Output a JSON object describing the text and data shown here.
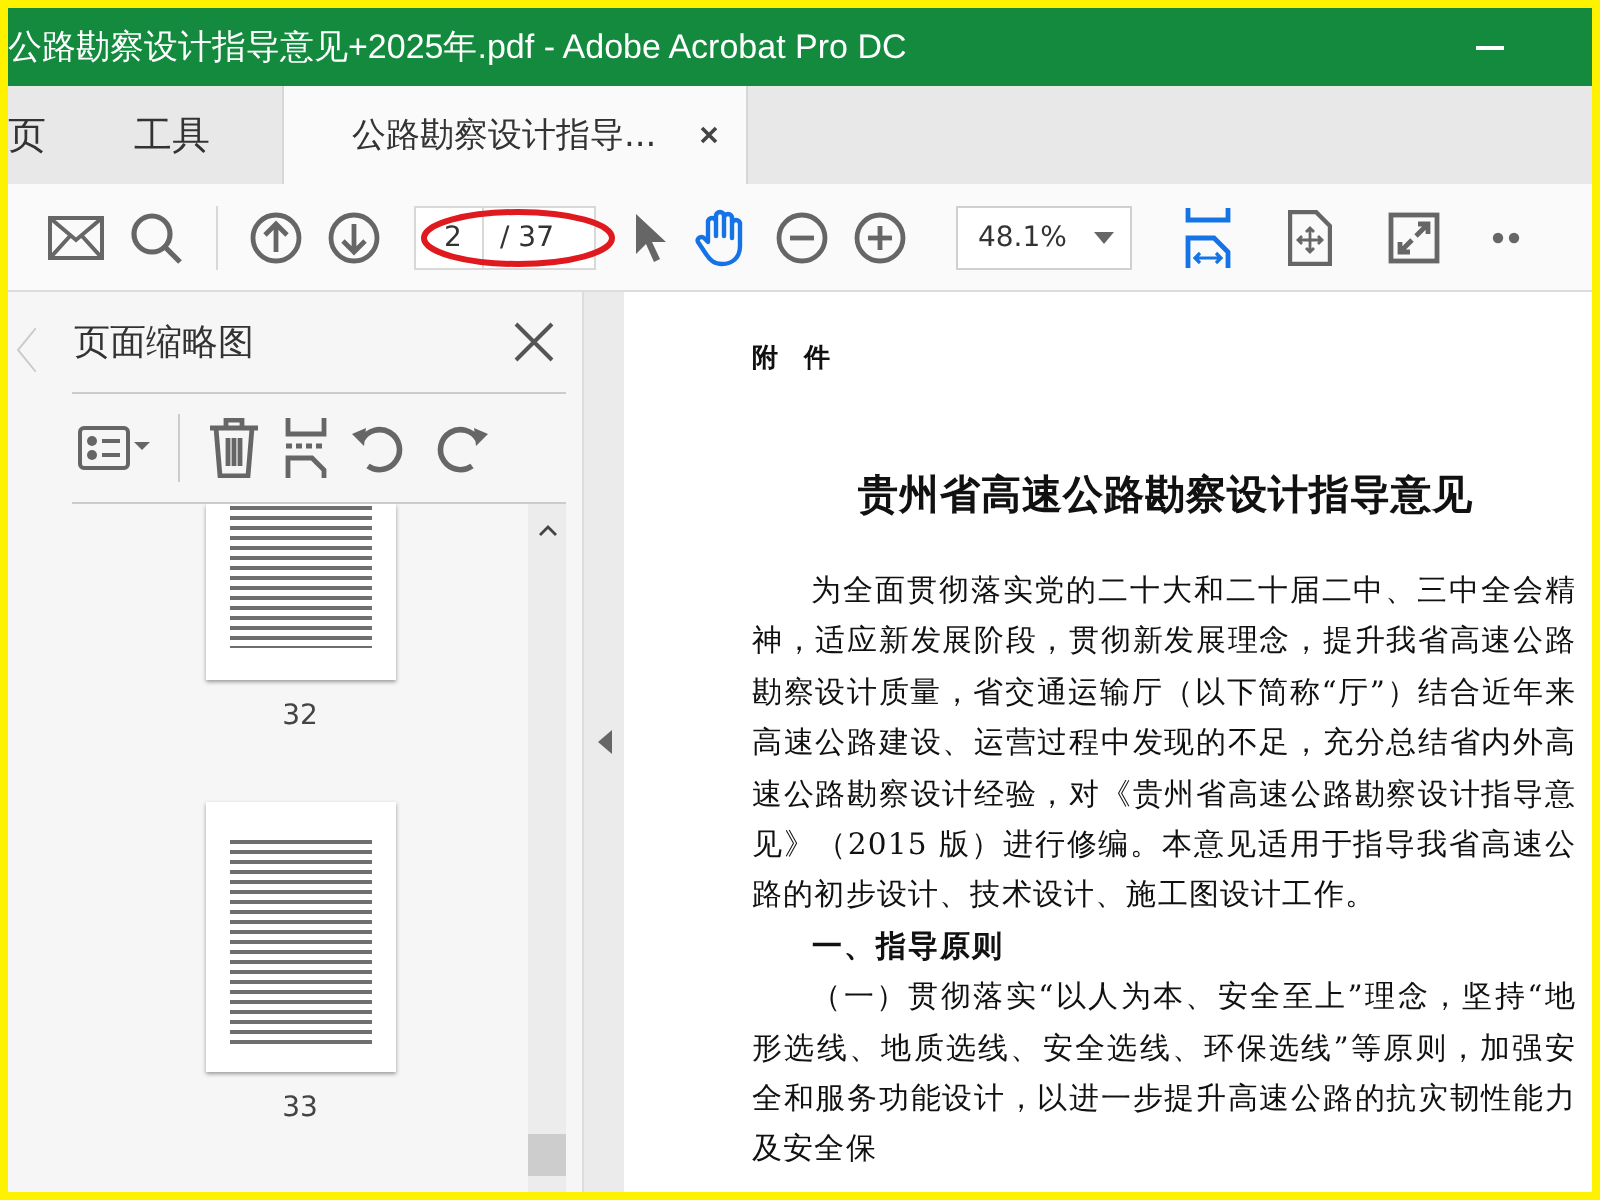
{
  "window": {
    "title": "公路勘察设计指导意见+2025年.pdf - Adobe Acrobat Pro DC"
  },
  "tabs": [
    {
      "label": "页",
      "selected": false
    },
    {
      "label": "工具",
      "selected": false
    },
    {
      "label": "公路勘察设计指导...",
      "selected": true
    }
  ],
  "toolbar": {
    "tools": [
      {
        "kind": "mail",
        "selected": false
      },
      {
        "kind": "search",
        "selected": false
      },
      {
        "kind": "sep"
      },
      {
        "kind": "up",
        "selected": false
      },
      {
        "kind": "down",
        "selected": false
      },
      {
        "kind": "page",
        "value": "2",
        "total": "/ 37"
      },
      {
        "kind": "pointer",
        "selected": false
      },
      {
        "kind": "hand",
        "selected": true
      },
      {
        "kind": "zoomout",
        "selected": false
      },
      {
        "kind": "zoomin",
        "selected": false
      },
      {
        "kind": "zoom",
        "value": "48.1%"
      },
      {
        "kind": "fitwidth",
        "selected": true
      },
      {
        "kind": "fitpage",
        "selected": false
      },
      {
        "kind": "fullscreen",
        "selected": false
      },
      {
        "kind": "more",
        "selected": false
      }
    ]
  },
  "sidebar": {
    "title": "页面缩略图",
    "thumbnails": [
      {
        "page": "32",
        "kind": "cut_top"
      },
      {
        "page": "33",
        "kind": "full"
      }
    ]
  },
  "document": {
    "heading": "附　件",
    "title": "贵州省高速公路勘察设计指导意见",
    "paragraphs": [
      {
        "kind": "body",
        "text": "为全面贯彻落实党的二十大和二十届二中、三中全会精神，适应新发展阶段，贯彻新发展理念，提升我省高速公路勘察设计质量，省交通运输厅（以下简称“厅”）结合近年来高速公路建设、运营过程中发现的不足，充分总结省内外高速公路勘察设计经验，对《贵州省高速公路勘察设计指导意见》（2015 版）进行修编。本意见适用于指导我省高速公路的初步设计、技术设计、施工图设计工作。"
      },
      {
        "kind": "section",
        "text": "一、指导原则"
      },
      {
        "kind": "body",
        "text": "（一）贯彻落实“以人为本、安全至上”理念，坚持“地形选线、地质选线、安全选线、环保选线”等原则，加强安全和服务功能设计，以进一步提升高速公路的抗灾韧性能力及安全保"
      }
    ]
  }
}
